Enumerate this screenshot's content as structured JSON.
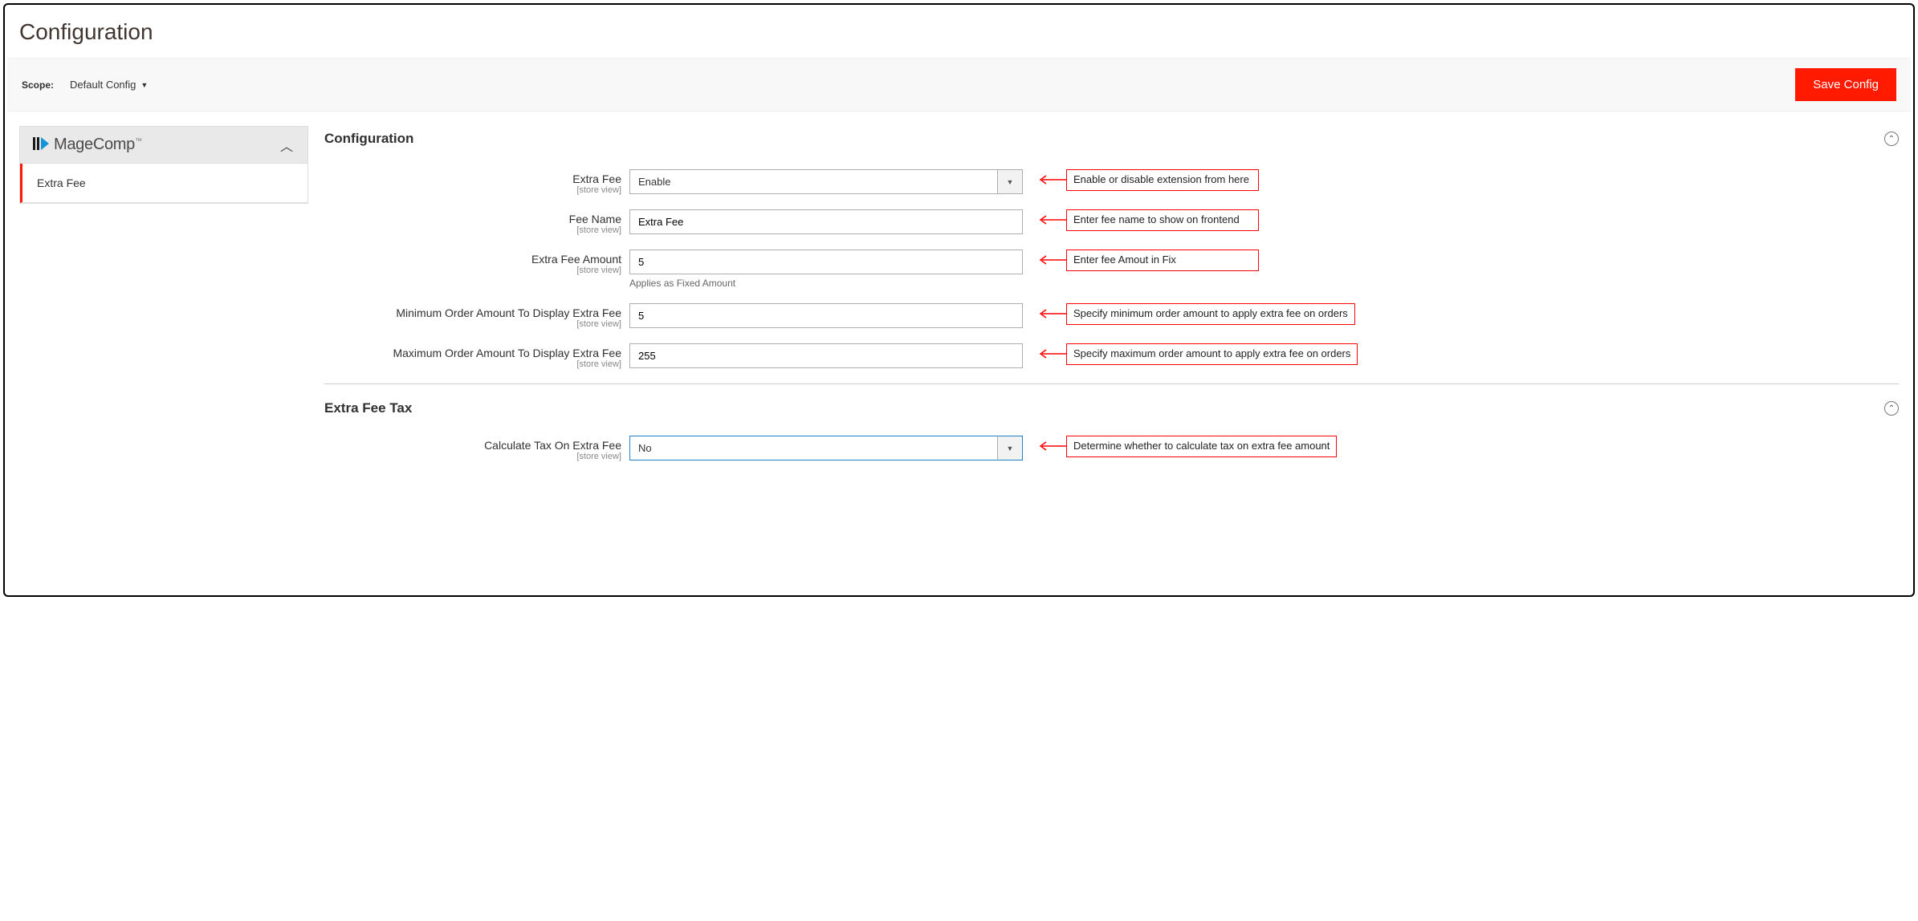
{
  "page_title": "Configuration",
  "toolbar": {
    "scope_label": "Scope:",
    "scope_value": "Default Config",
    "save_label": "Save Config"
  },
  "sidebar": {
    "brand": "MageComp",
    "items": [
      {
        "label": "Extra Fee"
      }
    ]
  },
  "sections": {
    "configuration": {
      "title": "Configuration",
      "fields": {
        "extra_fee": {
          "label": "Extra Fee",
          "scope": "[store view]",
          "value": "Enable",
          "callout": "Enable or disable extension from here"
        },
        "fee_name": {
          "label": "Fee Name",
          "scope": "[store view]",
          "value": "Extra Fee",
          "callout": "Enter fee name to show on frontend"
        },
        "fee_amount": {
          "label": "Extra Fee Amount",
          "scope": "[store view]",
          "value": "5",
          "note": "Applies as Fixed Amount",
          "callout": "Enter fee Amout in Fix"
        },
        "min_order": {
          "label": "Minimum Order Amount To Display Extra Fee",
          "scope": "[store view]",
          "value": "5",
          "callout": "Specify minimum order amount to apply extra fee on orders"
        },
        "max_order": {
          "label": "Maximum Order Amount To Display Extra Fee",
          "scope": "[store view]",
          "value": "255",
          "callout": "Specify maximum order amount to apply extra fee on orders"
        }
      }
    },
    "tax": {
      "title": "Extra Fee Tax",
      "fields": {
        "calculate_tax": {
          "label": "Calculate Tax On Extra Fee",
          "scope": "[store view]",
          "value": "No",
          "callout": "Determine whether to calculate tax on extra fee amount"
        }
      }
    }
  }
}
